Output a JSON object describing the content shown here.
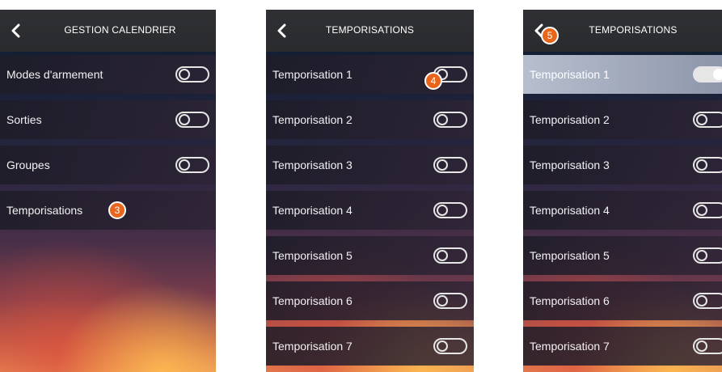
{
  "screens": [
    {
      "title": "GESTION CALENDRIER",
      "rows": [
        {
          "label": "Modes d'armement",
          "toggle": "off"
        },
        {
          "label": "Sorties",
          "toggle": "off"
        },
        {
          "label": "Groupes",
          "toggle": "off"
        },
        {
          "label": "Temporisations",
          "toggle": "none"
        }
      ],
      "badge": "3"
    },
    {
      "title": "TEMPORISATIONS",
      "rows": [
        {
          "label": "Temporisation 1",
          "toggle": "off"
        },
        {
          "label": "Temporisation 2",
          "toggle": "off"
        },
        {
          "label": "Temporisation 3",
          "toggle": "off"
        },
        {
          "label": "Temporisation 4",
          "toggle": "off"
        },
        {
          "label": "Temporisation 5",
          "toggle": "off"
        },
        {
          "label": "Temporisation 6",
          "toggle": "off"
        },
        {
          "label": "Temporisation 7",
          "toggle": "off"
        }
      ],
      "badge": "4"
    },
    {
      "title": "TEMPORISATIONS",
      "rows": [
        {
          "label": "Temporisation 1",
          "toggle": "on"
        },
        {
          "label": "Temporisation 2",
          "toggle": "off"
        },
        {
          "label": "Temporisation 3",
          "toggle": "off"
        },
        {
          "label": "Temporisation 4",
          "toggle": "off"
        },
        {
          "label": "Temporisation 5",
          "toggle": "off"
        },
        {
          "label": "Temporisation 6",
          "toggle": "off"
        },
        {
          "label": "Temporisation 7",
          "toggle": "off"
        }
      ],
      "badge": "5"
    }
  ],
  "colors": {
    "header": "#2e2f32",
    "badge": "#e8661c",
    "selected_row": "#aab2c4"
  },
  "icons": {
    "back": "chevron-left-icon",
    "toggle": "toggle-switch-icon"
  }
}
